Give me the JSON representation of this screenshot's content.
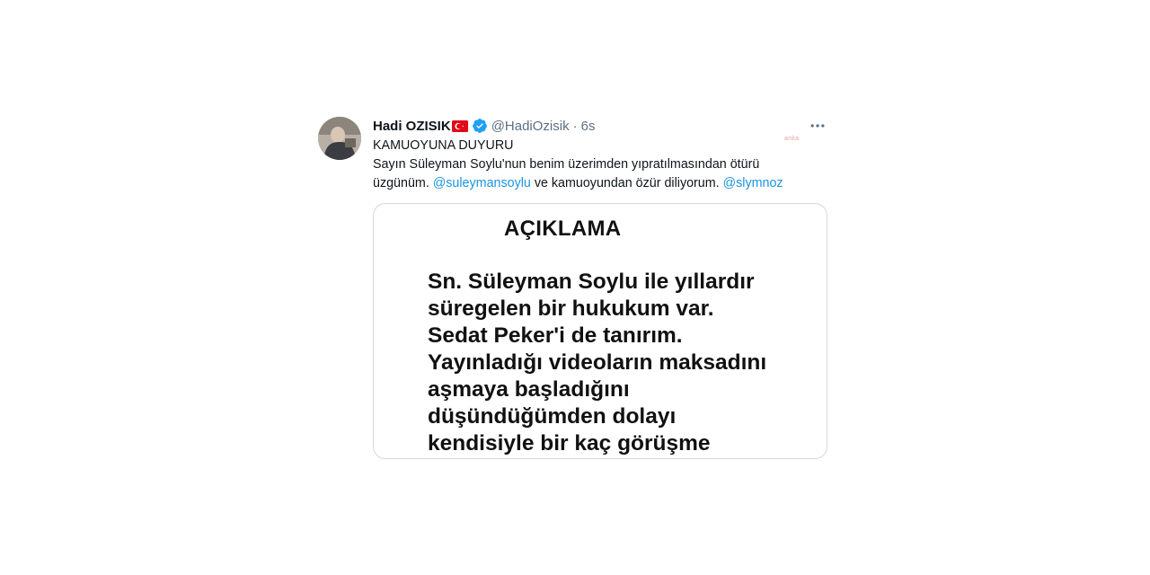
{
  "tweet": {
    "display_name": "Hadi OZISIK",
    "handle": "@HadiOzisik",
    "separator": "·",
    "time": "6s",
    "text_line_1": "KAMUOYUNA DUYURU",
    "text_part_a": "Sayın Süleyman Soylu'nun benim üzerimden yıpratılmasından ötürü üzgünüm. ",
    "mention_1": "@suleymansoylu",
    "text_part_b": " ve kamuoyundan özür diliyorum. ",
    "mention_2": "@slymnoz",
    "more_icon": "more-horizontal-icon",
    "flag_icon": "turkey-flag-icon",
    "verified_icon": "verified-badge-icon"
  },
  "watermark": "anka",
  "media": {
    "title": "AÇIKLAMA",
    "lines": [
      "Sn. Süleyman Soylu ile yıllardır",
      "süregelen bir hukukum var.",
      "Sedat Peker'i de tanırım.",
      "Yayınladığı videoların maksadını",
      "aşmaya başladığını",
      "düşündüğümden dolayı",
      "kendisiyle bir kaç görüşme"
    ]
  },
  "colors": {
    "link": "#1b95e0",
    "secondary_text": "#5b7083",
    "verified": "#1da1f2",
    "flag_red": "#e30a17",
    "border": "#cfd9de"
  }
}
